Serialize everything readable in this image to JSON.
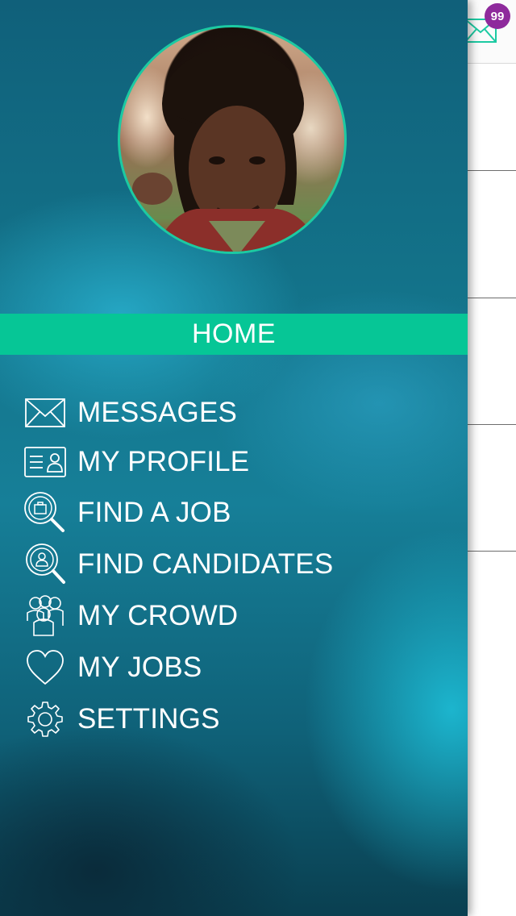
{
  "app": {
    "accent_color": "#06c696",
    "badge_color": "#8e2a9c"
  },
  "header": {
    "mail_icon": "envelope-icon",
    "unread_count": "99"
  },
  "drawer": {
    "avatar": {
      "description": "profile-photo"
    },
    "home_label": "HOME",
    "items": [
      {
        "label": "MESSAGES",
        "icon": "envelope-icon"
      },
      {
        "label": "MY PROFILE",
        "icon": "id-card-icon"
      },
      {
        "label": "FIND A JOB",
        "icon": "search-briefcase-icon"
      },
      {
        "label": "FIND CANDIDATES",
        "icon": "search-person-icon"
      },
      {
        "label": "MY CROWD",
        "icon": "people-group-icon"
      },
      {
        "label": "MY JOBS",
        "icon": "heart-icon"
      },
      {
        "label": "SETTINGS",
        "icon": "gear-icon"
      }
    ]
  }
}
